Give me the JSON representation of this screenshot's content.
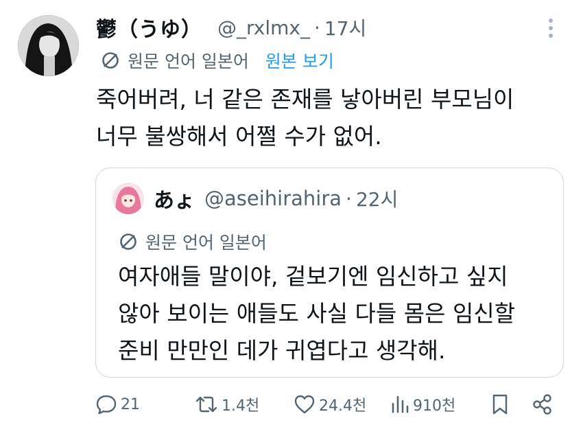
{
  "tweet": {
    "author_name": "鬱（うゆ）",
    "handle": "@_rxlmx_",
    "separator": "·",
    "time": "17시",
    "lang_label": "원문 언어 일본어",
    "show_original": "원본 보기",
    "text_lines": [
      "죽어버려, 너 같은 존재를 낳아버린 부모님이",
      "너무 불쌍해서 어쩔 수가 없어."
    ]
  },
  "quote": {
    "author_name": "あょ",
    "handle": "@aseihirahira",
    "separator": "·",
    "time": "22시",
    "lang_label": "원문 언어 일본어",
    "text_lines": [
      "여자애들 말이야, 겉보기엔 임신하고 싶지",
      "않아 보이는 애들도 사실 다들 몸은 임신할",
      "준비 만만인 데가 귀엽다고 생각해."
    ]
  },
  "actions": {
    "reply_count": "21",
    "retweet_count": "1.4천",
    "like_count": "24.4천",
    "view_count": "910천"
  },
  "icons": {
    "reply": "reply-icon",
    "retweet": "retweet-icon",
    "like": "heart-icon",
    "views": "views-icon",
    "bookmark": "bookmark-icon",
    "share": "share-icon",
    "translate": "translate-icon",
    "more": "more-icon"
  },
  "colors": {
    "text": "#0f1419",
    "secondary": "#536471",
    "link": "#1d9bf0",
    "border": "#cfd9de"
  }
}
